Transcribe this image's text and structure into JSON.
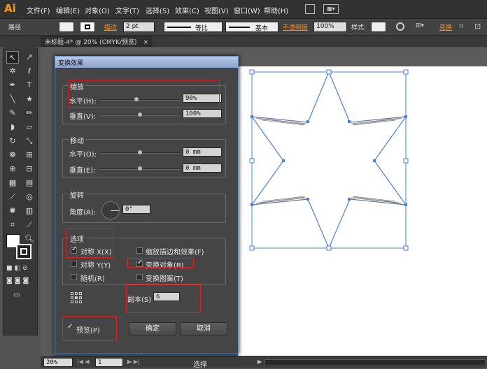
{
  "app": {
    "logo": "Ai",
    "menus": [
      "文件(F)",
      "编辑(E)",
      "对象(O)",
      "文字(T)",
      "选择(S)",
      "效果(C)",
      "视图(V)",
      "窗口(W)",
      "帮助(H)"
    ]
  },
  "control": {
    "object_type": "路径",
    "stroke_label": "描边",
    "stroke_weight": "2 pt",
    "profile_uniform": "等比",
    "brush_basic": "基本",
    "opacity_label": "不透明度",
    "opacity_value": "100%",
    "style_label": "样式:",
    "transform_label": "变换"
  },
  "document": {
    "tab_title": "未标题-4* @ 20% (CMYK/预览)",
    "close": "×"
  },
  "status": {
    "zoom": "20%",
    "page": "1",
    "tool": "选择"
  },
  "dialog": {
    "title": "变换效果",
    "scale": {
      "title": "缩放",
      "horizontal_label": "水平(H):",
      "horizontal_value": "90%",
      "vertical_label": "垂直(V):",
      "vertical_value": "100%",
      "horizontal_level": 0.45,
      "vertical_level": 0.5
    },
    "move": {
      "title": "移动",
      "horizontal_label": "水平(O):",
      "horizontal_value": "0 mm",
      "vertical_label": "垂直(E):",
      "vertical_value": "0 mm"
    },
    "rotate": {
      "title": "旋转",
      "angle_label": "角度(A):",
      "angle_value": "0°"
    },
    "options": {
      "title": "选项",
      "reflect_x": "对称 X(X)",
      "reflect_y": "对称 Y(Y)",
      "random": "随机(R)",
      "scale_strokes": "缩放描边和效果(F)",
      "transform_objects": "变换对象(B)",
      "transform_patterns": "变换图案(T)"
    },
    "copies_label": "副本(S)",
    "copies_value": "6",
    "preview_label": "预览(P)",
    "ok": "确定",
    "cancel": "取消"
  },
  "colors": {
    "accent": "#ff8c1a",
    "selection": "#4a7fd8",
    "highlight": "#e02020"
  }
}
